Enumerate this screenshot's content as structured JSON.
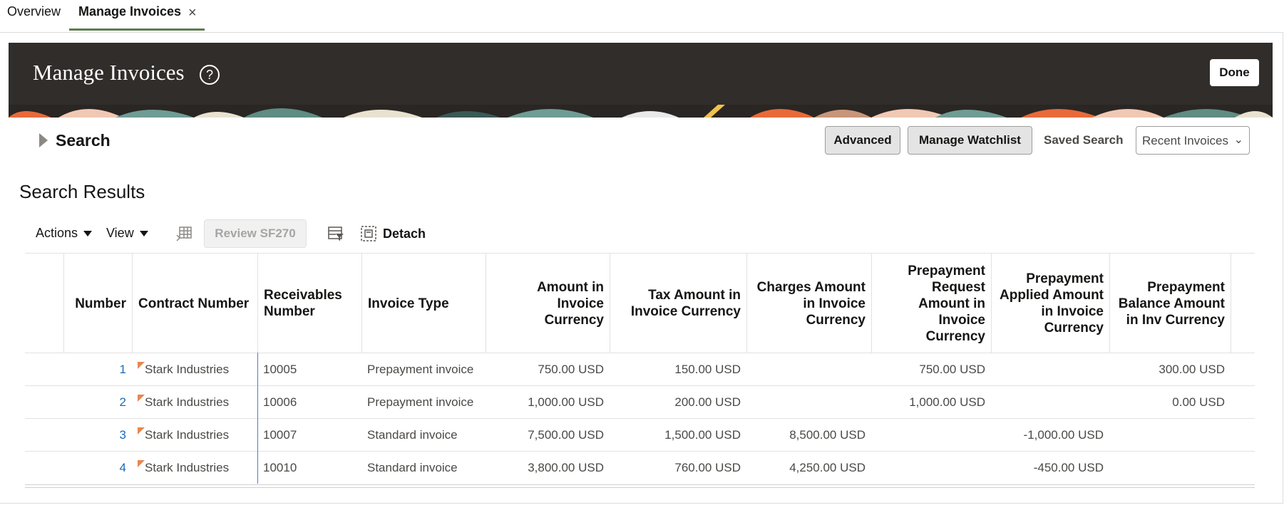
{
  "tabs": {
    "overview": "Overview",
    "active": "Manage Invoices",
    "close": "×"
  },
  "header": {
    "title": "Manage Invoices",
    "help": "?",
    "done": "Done"
  },
  "search": {
    "label": "Search",
    "advanced": "Advanced",
    "manage_watchlist": "Manage Watchlist",
    "saved_search_label": "Saved Search",
    "saved_search_value": "Recent Invoices",
    "chevron": "⌄"
  },
  "results": {
    "title": "Search Results",
    "toolbar": {
      "actions": "Actions",
      "view": "View",
      "review": "Review SF270",
      "detach": "Detach"
    },
    "columns": [
      "Number",
      "Contract Number",
      "Receivables Number",
      "Invoice Type",
      "Amount in Invoice Currency",
      "Tax Amount in Invoice Currency",
      "Charges Amount in Invoice Currency",
      "Prepayment Request Amount in Invoice Currency",
      "Prepayment Applied Amount in Invoice Currency",
      "Prepayment Balance Amount in Inv Currency"
    ],
    "rows": [
      {
        "number": "1",
        "contract": "Stark Industries",
        "receivables": "10005",
        "type": "Prepayment invoice",
        "amount": "750.00 USD",
        "tax": "150.00 USD",
        "charges": "",
        "prep_request": "750.00 USD",
        "prep_applied": "",
        "prep_balance": "300.00 USD"
      },
      {
        "number": "2",
        "contract": "Stark Industries",
        "receivables": "10006",
        "type": "Prepayment invoice",
        "amount": "1,000.00 USD",
        "tax": "200.00 USD",
        "charges": "",
        "prep_request": "1,000.00 USD",
        "prep_applied": "",
        "prep_balance": "0.00 USD"
      },
      {
        "number": "3",
        "contract": "Stark Industries",
        "receivables": "10007",
        "type": "Standard invoice",
        "amount": "7,500.00 USD",
        "tax": "1,500.00 USD",
        "charges": "8,500.00 USD",
        "prep_request": "",
        "prep_applied": "-1,000.00 USD",
        "prep_balance": ""
      },
      {
        "number": "4",
        "contract": "Stark Industries",
        "receivables": "10010",
        "type": "Standard invoice",
        "amount": "3,800.00 USD",
        "tax": "760.00 USD",
        "charges": "4,250.00 USD",
        "prep_request": "",
        "prep_applied": "-450.00 USD",
        "prep_balance": ""
      }
    ]
  },
  "colors": {
    "banner": "#312d2a",
    "tab_underline": "#5b7c4e",
    "link": "#1a6ab5",
    "flag": "#e8874f"
  },
  "icons": {
    "help": "help-icon",
    "close": "close-icon",
    "freeze": "freeze-columns-icon",
    "filter": "query-by-example-icon",
    "detach": "detach-icon"
  }
}
